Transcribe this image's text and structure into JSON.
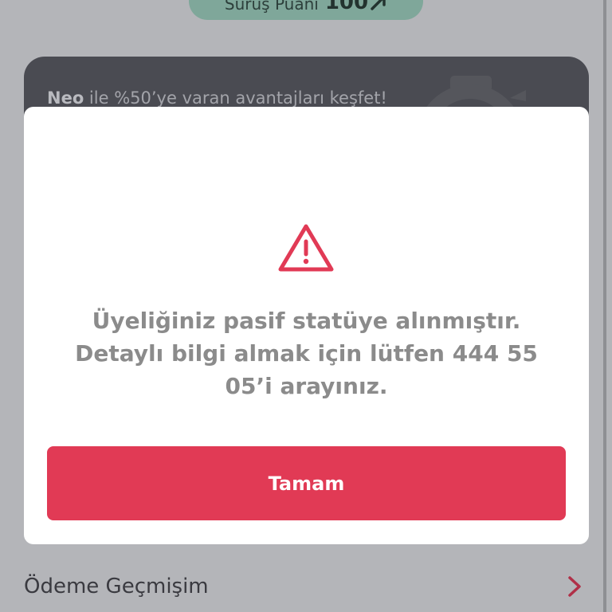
{
  "score": {
    "label": "Sürüş Puanı",
    "value": "100",
    "icon": "trend-up-icon"
  },
  "promo": {
    "brand": "Neo",
    "text": " ile %50’ye varan avantajları keşfet!",
    "icon": "speedometer-icon"
  },
  "modal": {
    "icon": "warning-icon",
    "message": "Üyeliğiniz pasif statüye alınmıştır. Detaylı bilgi almak için lütfen 444 55 05’i arayınız.",
    "button_label": "Tamam"
  },
  "menu": {
    "items": [
      {
        "label": "Ödeme Geçmişim",
        "icon": "chevron-right-icon"
      }
    ]
  },
  "colors": {
    "accent": "#e13a55",
    "overlay": "#b4b5b9",
    "card": "#4a4b52",
    "pill": "#7fa79a",
    "message_text": "#8b8b8b"
  }
}
